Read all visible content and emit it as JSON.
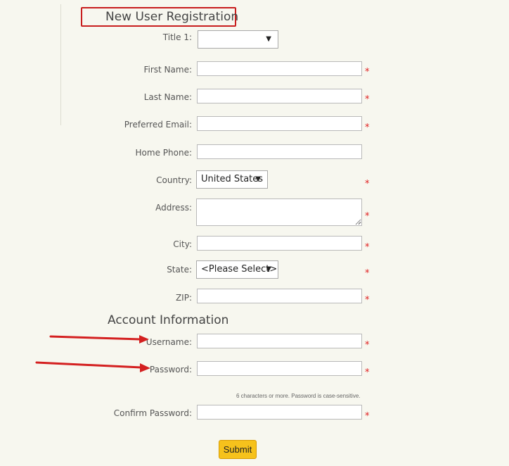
{
  "form": {
    "title": "New User Registration",
    "fields": {
      "title1": {
        "label": "Title 1:",
        "value": ""
      },
      "first_name": {
        "label": "First Name:"
      },
      "last_name": {
        "label": "Last Name:"
      },
      "preferred_email": {
        "label": "Preferred Email:"
      },
      "home_phone": {
        "label": "Home Phone:"
      },
      "country": {
        "label": "Country:",
        "value": "United States"
      },
      "address": {
        "label": "Address:"
      },
      "city": {
        "label": "City:"
      },
      "state": {
        "label": "State:",
        "value": "<Please Select>"
      },
      "zip": {
        "label": "ZIP:"
      }
    },
    "required_marker": "*"
  },
  "account": {
    "title": "Account Information",
    "username_label": "Username:",
    "password_label": "Password:",
    "password_hint": "6 characters or more. Password is case-sensitive.",
    "confirm_password_label": "Confirm Password:",
    "submit_label": "Submit"
  },
  "icons": {
    "dropdown": "triangle-down",
    "annotation": "red-arrow"
  },
  "colors": {
    "highlight": "#c81e1e",
    "required": "#e02020",
    "submit": "#f6c21c",
    "background": "#f7f7ef"
  }
}
